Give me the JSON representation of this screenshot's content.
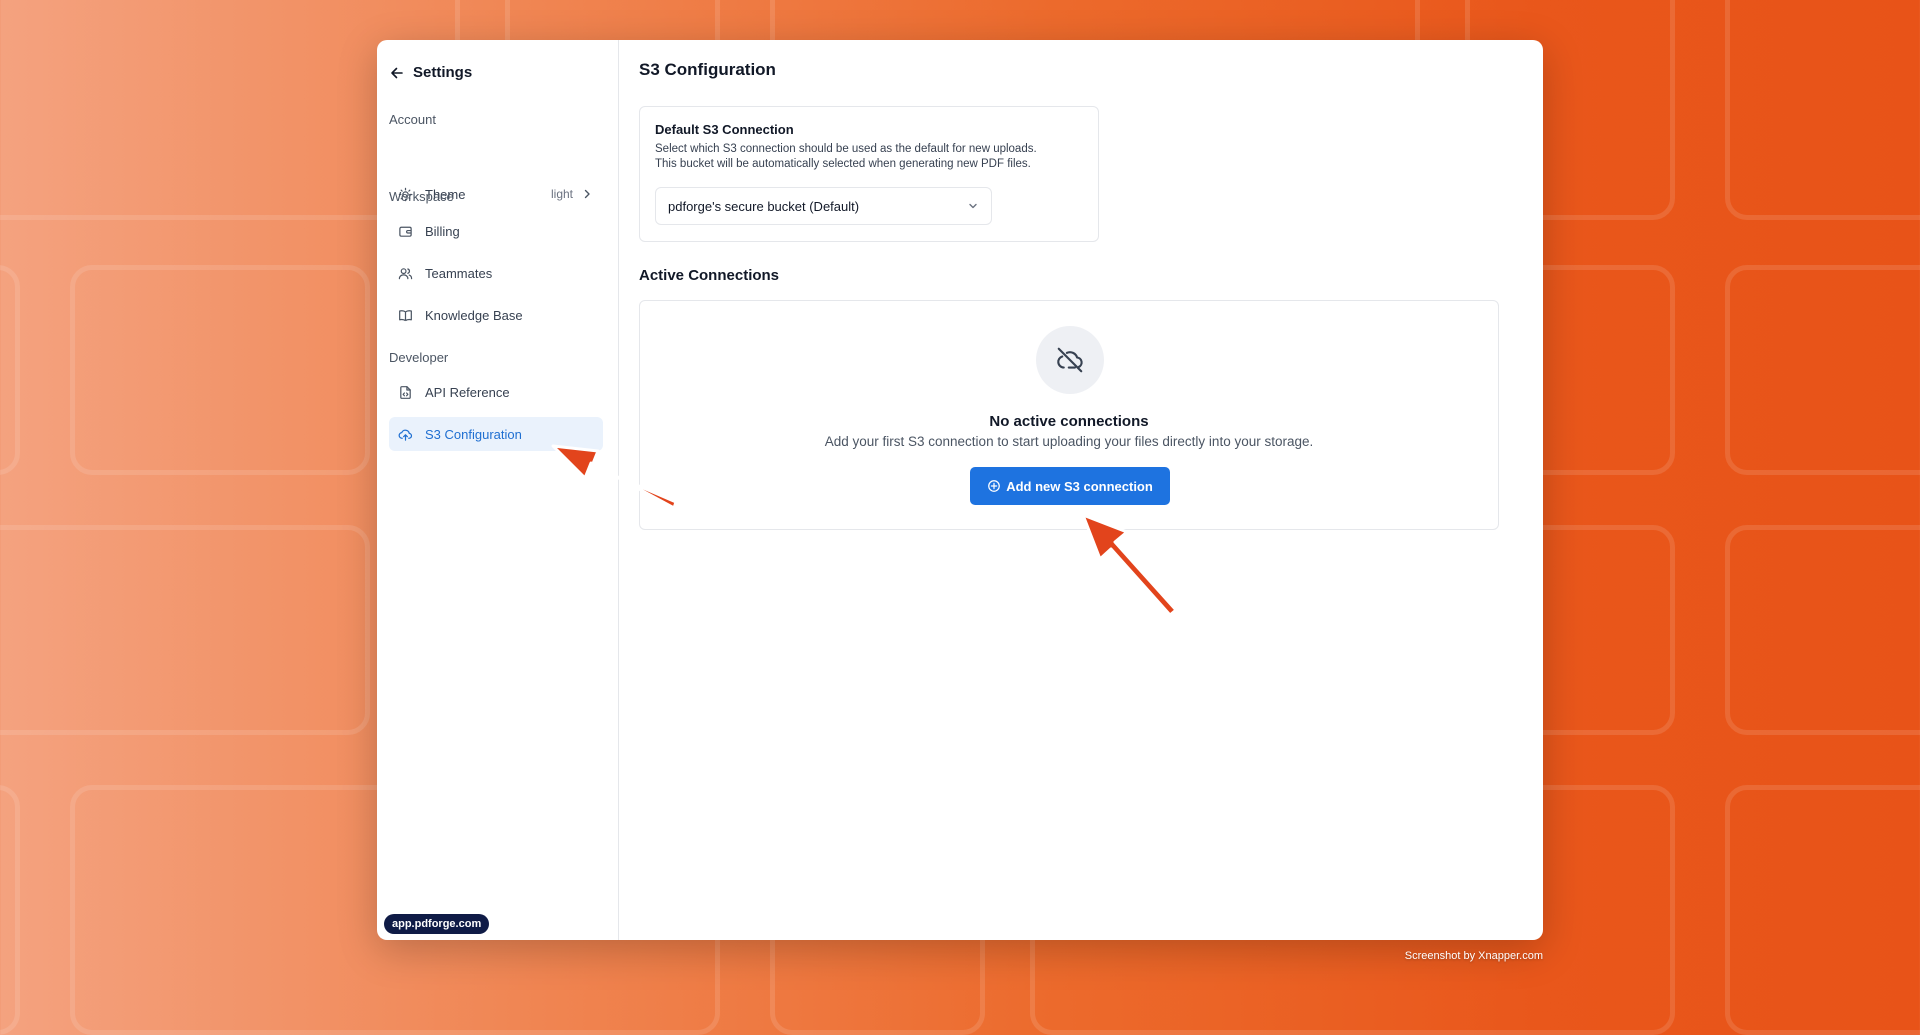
{
  "sidebar": {
    "header": {
      "title": "Settings",
      "back_icon": "arrow-left-icon"
    },
    "sections": {
      "account": "Account",
      "workspace": "Workspace",
      "developer": "Developer"
    },
    "items": {
      "theme": {
        "label": "Theme",
        "value": "light",
        "icon": "sun-icon"
      },
      "billing": {
        "label": "Billing",
        "icon": "wallet-icon"
      },
      "teammates": {
        "label": "Teammates",
        "icon": "users-icon"
      },
      "knowledge_base": {
        "label": "Knowledge Base",
        "icon": "book-open-icon"
      },
      "api_reference": {
        "label": "API Reference",
        "icon": "file-code-icon"
      },
      "s3_configuration": {
        "label": "S3 Configuration",
        "icon": "cloud-upload-icon",
        "active": true
      }
    },
    "url_badge": "app.pdforge.com"
  },
  "main": {
    "title": "S3 Configuration",
    "default_connection": {
      "title": "Default S3 Connection",
      "description_line1": "Select which S3 connection should be used as the default for new uploads.",
      "description_line2": "This bucket will be automatically selected when generating new PDF files.",
      "selected_value": "pdforge's secure bucket (Default)"
    },
    "active_connections": {
      "title": "Active Connections",
      "empty_icon": "cloud-off-icon",
      "empty_title": "No active connections",
      "empty_description": "Add your first S3 connection to start uploading your files directly into your storage.",
      "add_button_label": "Add new S3 connection",
      "add_button_icon": "plus-circle-icon"
    }
  },
  "watermark": "Screenshot by Xnapper.com",
  "colors": {
    "accent": "#1e73e0",
    "active_bg": "#eaf2fc",
    "active_text": "#1f6fd1",
    "annotation_arrow": "#e2441c"
  }
}
